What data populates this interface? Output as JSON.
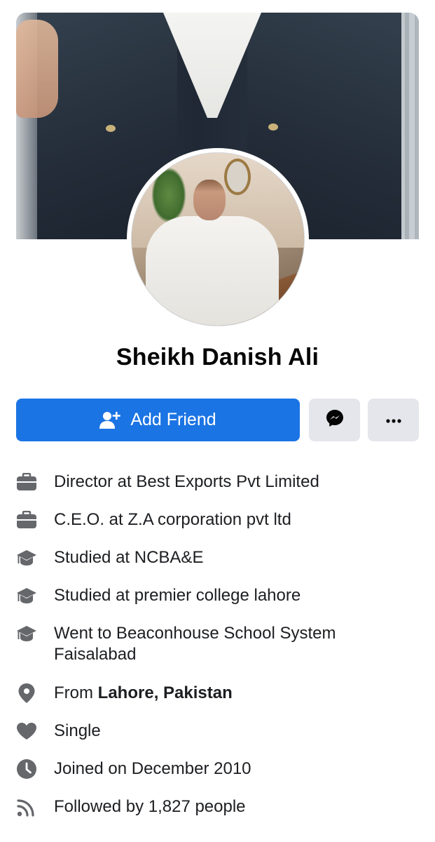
{
  "profile": {
    "name": "Sheikh Danish Ali"
  },
  "actions": {
    "add_friend_label": "Add Friend",
    "primary_color": "#1b74e4",
    "secondary_bg": "#e4e6eb"
  },
  "details": [
    {
      "icon": "briefcase-icon",
      "text": "Director at Best Exports Pvt Limited"
    },
    {
      "icon": "briefcase-icon",
      "text": "C.E.O. at Z.A corporation pvt ltd"
    },
    {
      "icon": "graduation-cap-icon",
      "text": "Studied at NCBA&E"
    },
    {
      "icon": "graduation-cap-icon",
      "text": "Studied at premier college lahore"
    },
    {
      "icon": "graduation-cap-icon",
      "text": "Went to Beaconhouse School System Faisalabad"
    },
    {
      "icon": "location-pin-icon",
      "prefix": "From ",
      "bold": "Lahore, Pakistan"
    },
    {
      "icon": "heart-icon",
      "text": "Single"
    },
    {
      "icon": "clock-icon",
      "text": "Joined on December 2010"
    },
    {
      "icon": "rss-feed-icon",
      "text": "Followed by 1,827 people"
    }
  ]
}
